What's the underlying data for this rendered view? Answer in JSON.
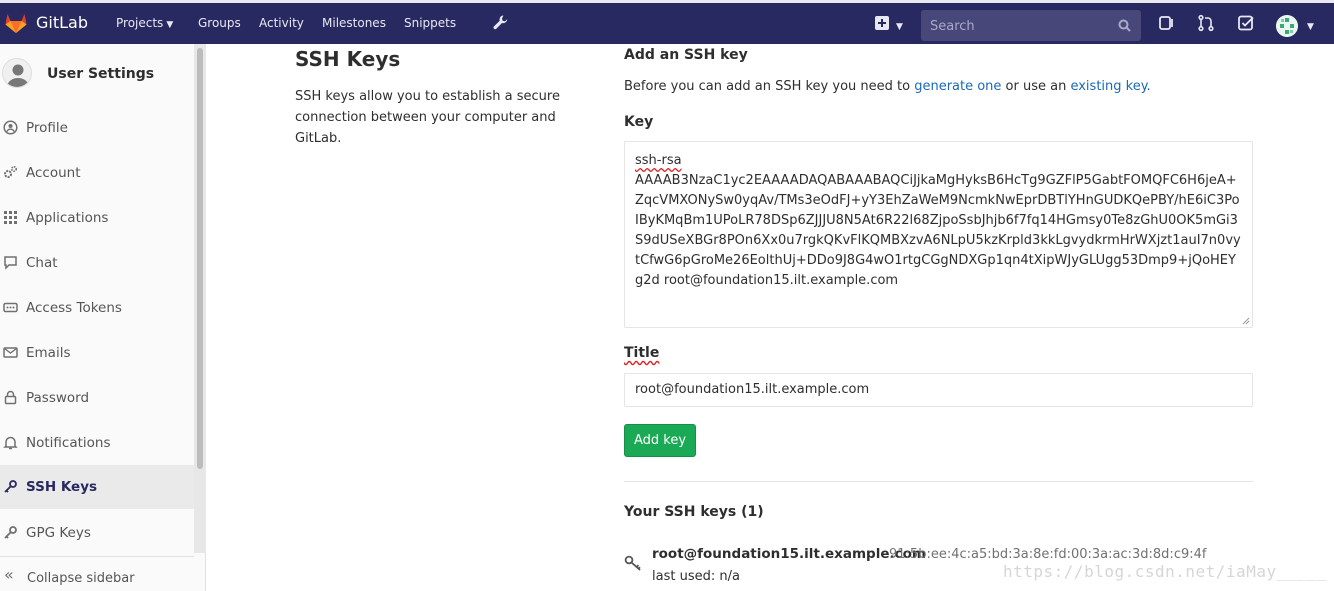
{
  "topbar": {
    "brand": "GitLab",
    "nav": [
      "Projects",
      "Groups",
      "Activity",
      "Milestones",
      "Snippets"
    ],
    "search_placeholder": "Search"
  },
  "sidebar": {
    "title": "User Settings",
    "items": [
      {
        "label": "Profile",
        "icon": "profile-icon"
      },
      {
        "label": "Account",
        "icon": "account-gears-icon"
      },
      {
        "label": "Applications",
        "icon": "applications-grid-icon"
      },
      {
        "label": "Chat",
        "icon": "chat-icon"
      },
      {
        "label": "Access Tokens",
        "icon": "token-icon"
      },
      {
        "label": "Emails",
        "icon": "envelope-icon"
      },
      {
        "label": "Password",
        "icon": "lock-icon"
      },
      {
        "label": "Notifications",
        "icon": "bell-icon"
      },
      {
        "label": "SSH Keys",
        "icon": "key-icon",
        "active": true
      },
      {
        "label": "GPG Keys",
        "icon": "key-icon"
      }
    ],
    "collapse_label": "Collapse sidebar"
  },
  "page": {
    "title": "SSH Keys",
    "description": "SSH keys allow you to establish a secure connection between your computer and GitLab.",
    "add_heading": "Add an SSH key",
    "intro_before": "Before you can add an SSH key you need to ",
    "intro_link1": "generate one",
    "intro_middle": " or use an ",
    "intro_link2": "existing key.",
    "key_label": "Key",
    "key_prefix": "ssh-rsa",
    "key_body": "AAAAB3NzaC1yc2EAAAADAQABAAABAQCiJjkaMgHyksB6HcTg9GZFlP5GabtFOMQFC6H6jeA+ZqcVMXONySw0yqAv/TMs3eOdFJ+yY3EhZaWeM9NcmkNwEprDBTlYHnGUDKQePBY/hE6iC3PoIByKMqBm1UPoLR78DSp6ZJJJU8N5At6R22l68ZjpoSsbJhjb6f7fq14HGmsy0Te8zGhU0OK5mGi3S9dUSeXBGr8POn6Xx0u7rgkQKvFlKQMBXzvA6NLpU5kzKrpld3kkLgvydkrmHrWXjzt1auI7n0vytCfwG6pGroMe26EolthUj+DDo9J8G4wO1rtgCGgNDXGp1qn4tXipWJyGLUgg53Dmp9+jQoHEYg2d root@foundation15.ilt.example.com",
    "title_label": "Title",
    "title_value": "root@foundation15.ilt.example.com",
    "add_button": "Add key",
    "your_keys": "Your SSH keys (1)",
    "keys": [
      {
        "name": "root@foundation15.ilt.example.com",
        "fingerprint": "91:5b:ee:4c:a5:bd:3a:8e:fd:00:3a:ac:3d:8d:c9:4f",
        "last_used": "last used: n/a"
      }
    ]
  },
  "watermark": "https://blog.csdn.net/iaMay_____"
}
